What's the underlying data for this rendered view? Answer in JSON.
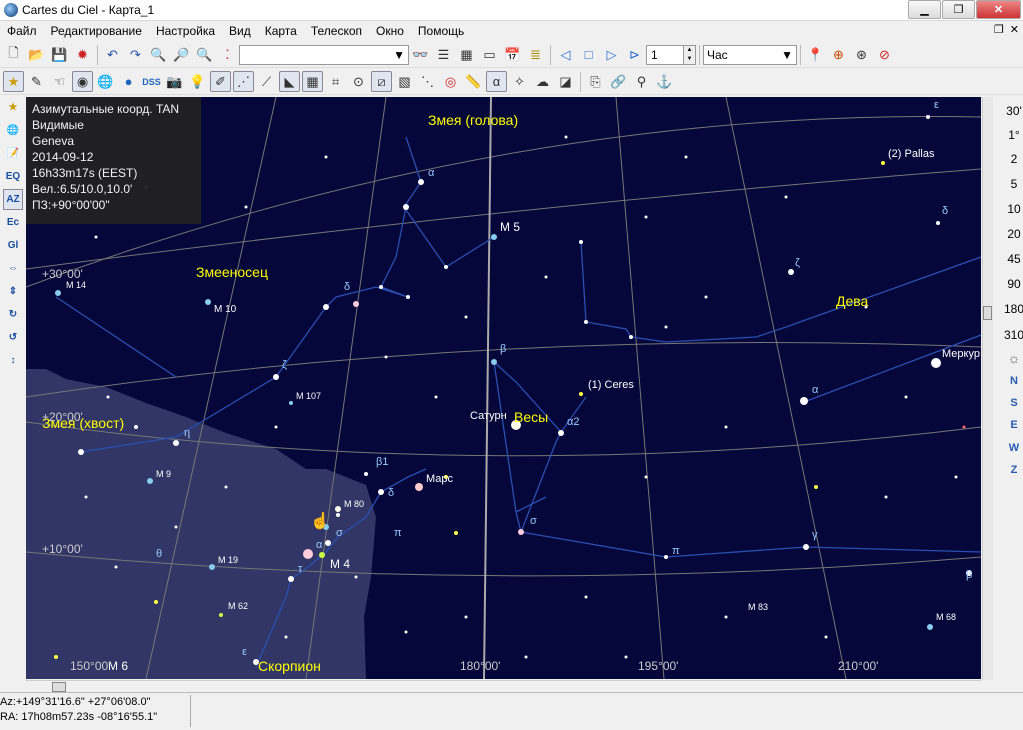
{
  "window": {
    "title": "Cartes du Ciel - Карта_1",
    "minimize": "▁",
    "restore": "❐",
    "close": "✕"
  },
  "menu": [
    "Файл",
    "Редактирование",
    "Настройка",
    "Вид",
    "Карта",
    "Телескоп",
    "Окно",
    "Помощь"
  ],
  "menu_right": [
    "❐",
    "✕"
  ],
  "toolbar1": {
    "search_value": "",
    "page_value": "1",
    "unit_value": "Час"
  },
  "info": {
    "lines": [
      "Азимутальные коорд. TAN",
      "Видимые",
      "Geneva",
      "2014-09-12",
      "16h33m17s (EEST)",
      "Вел.:6.5/10.0,10.0'",
      "ПЗ:+90°00'00\""
    ]
  },
  "left_buttons": [
    "EQ",
    "AZ",
    "Ec",
    "Gl"
  ],
  "fov_values": [
    "30'",
    "1°",
    "1",
    "2",
    "5",
    "10",
    "20",
    "45",
    "90",
    "180",
    "310"
  ],
  "directions": [
    "N",
    "S",
    "E",
    "W",
    "Z"
  ],
  "constellations": [
    {
      "id": "serpens-head",
      "text": "Змея (голова)"
    },
    {
      "id": "ophiuchus",
      "text": "Змееносец"
    },
    {
      "id": "virgo",
      "text": "Дева"
    },
    {
      "id": "serpens-tail",
      "text": "Змея (хвост)"
    },
    {
      "id": "libra",
      "text": "Весы"
    },
    {
      "id": "scorpius",
      "text": "Скорпион"
    }
  ],
  "objects": [
    {
      "id": "m5",
      "text": "M 5"
    },
    {
      "id": "m14",
      "text": "M 14"
    },
    {
      "id": "m10",
      "text": "M 10"
    },
    {
      "id": "m107",
      "text": "M 107"
    },
    {
      "id": "m9",
      "text": "M 9"
    },
    {
      "id": "m80",
      "text": "M 80"
    },
    {
      "id": "m4",
      "text": "M 4"
    },
    {
      "id": "m19",
      "text": "M 19"
    },
    {
      "id": "m62",
      "text": "M 62"
    },
    {
      "id": "m6",
      "text": "M 6"
    },
    {
      "id": "m83",
      "text": "M 83"
    },
    {
      "id": "m68",
      "text": "M 68"
    },
    {
      "id": "pallas",
      "text": "(2) Pallas"
    },
    {
      "id": "ceres",
      "text": "(1) Ceres"
    },
    {
      "id": "saturn",
      "text": "Сатурн"
    },
    {
      "id": "mars",
      "text": "Марс"
    },
    {
      "id": "mercury",
      "text": "Меркур"
    }
  ],
  "grid_labels": [
    {
      "id": "dec30",
      "text": "+30°00'"
    },
    {
      "id": "dec20",
      "text": "+20°00'"
    },
    {
      "id": "dec10",
      "text": "+10°00'"
    },
    {
      "id": "az150",
      "text": "150°00'"
    },
    {
      "id": "az180",
      "text": "180°00'"
    },
    {
      "id": "az195",
      "text": "195°00'"
    },
    {
      "id": "az210",
      "text": "210°00'"
    }
  ],
  "greek": [
    {
      "id": "alpha-ser",
      "text": "α"
    },
    {
      "id": "delta-oph",
      "text": "δ"
    },
    {
      "id": "zeta-oph",
      "text": "ζ"
    },
    {
      "id": "eta-oph",
      "text": "η"
    },
    {
      "id": "beta-lib",
      "text": "β"
    },
    {
      "id": "alpha2-lib",
      "text": "α2"
    },
    {
      "id": "beta1-sco",
      "text": "β1"
    },
    {
      "id": "delta-sco",
      "text": "δ"
    },
    {
      "id": "sigma-lib",
      "text": "σ"
    },
    {
      "id": "sigma-sco",
      "text": "σ"
    },
    {
      "id": "pi-sco",
      "text": "π"
    },
    {
      "id": "alpha-sco",
      "text": "α"
    },
    {
      "id": "tau-sco",
      "text": "τ"
    },
    {
      "id": "theta-oph",
      "text": "θ"
    },
    {
      "id": "epsilon-sco",
      "text": "ε"
    },
    {
      "id": "pi-lib",
      "text": "π"
    },
    {
      "id": "gamma-vir",
      "text": "γ"
    },
    {
      "id": "alpha-vir",
      "text": "α"
    },
    {
      "id": "zeta-vir",
      "text": "ζ"
    },
    {
      "id": "delta-vir",
      "text": "δ"
    },
    {
      "id": "epsilon-vir",
      "text": "ε"
    },
    {
      "id": "beta-crv",
      "text": "β"
    }
  ],
  "status": {
    "az": "Az:+149°31'16.6\" +27°06'08.0\"",
    "ra": "RA: 17h08m57.23s -08°16'55.1\""
  }
}
